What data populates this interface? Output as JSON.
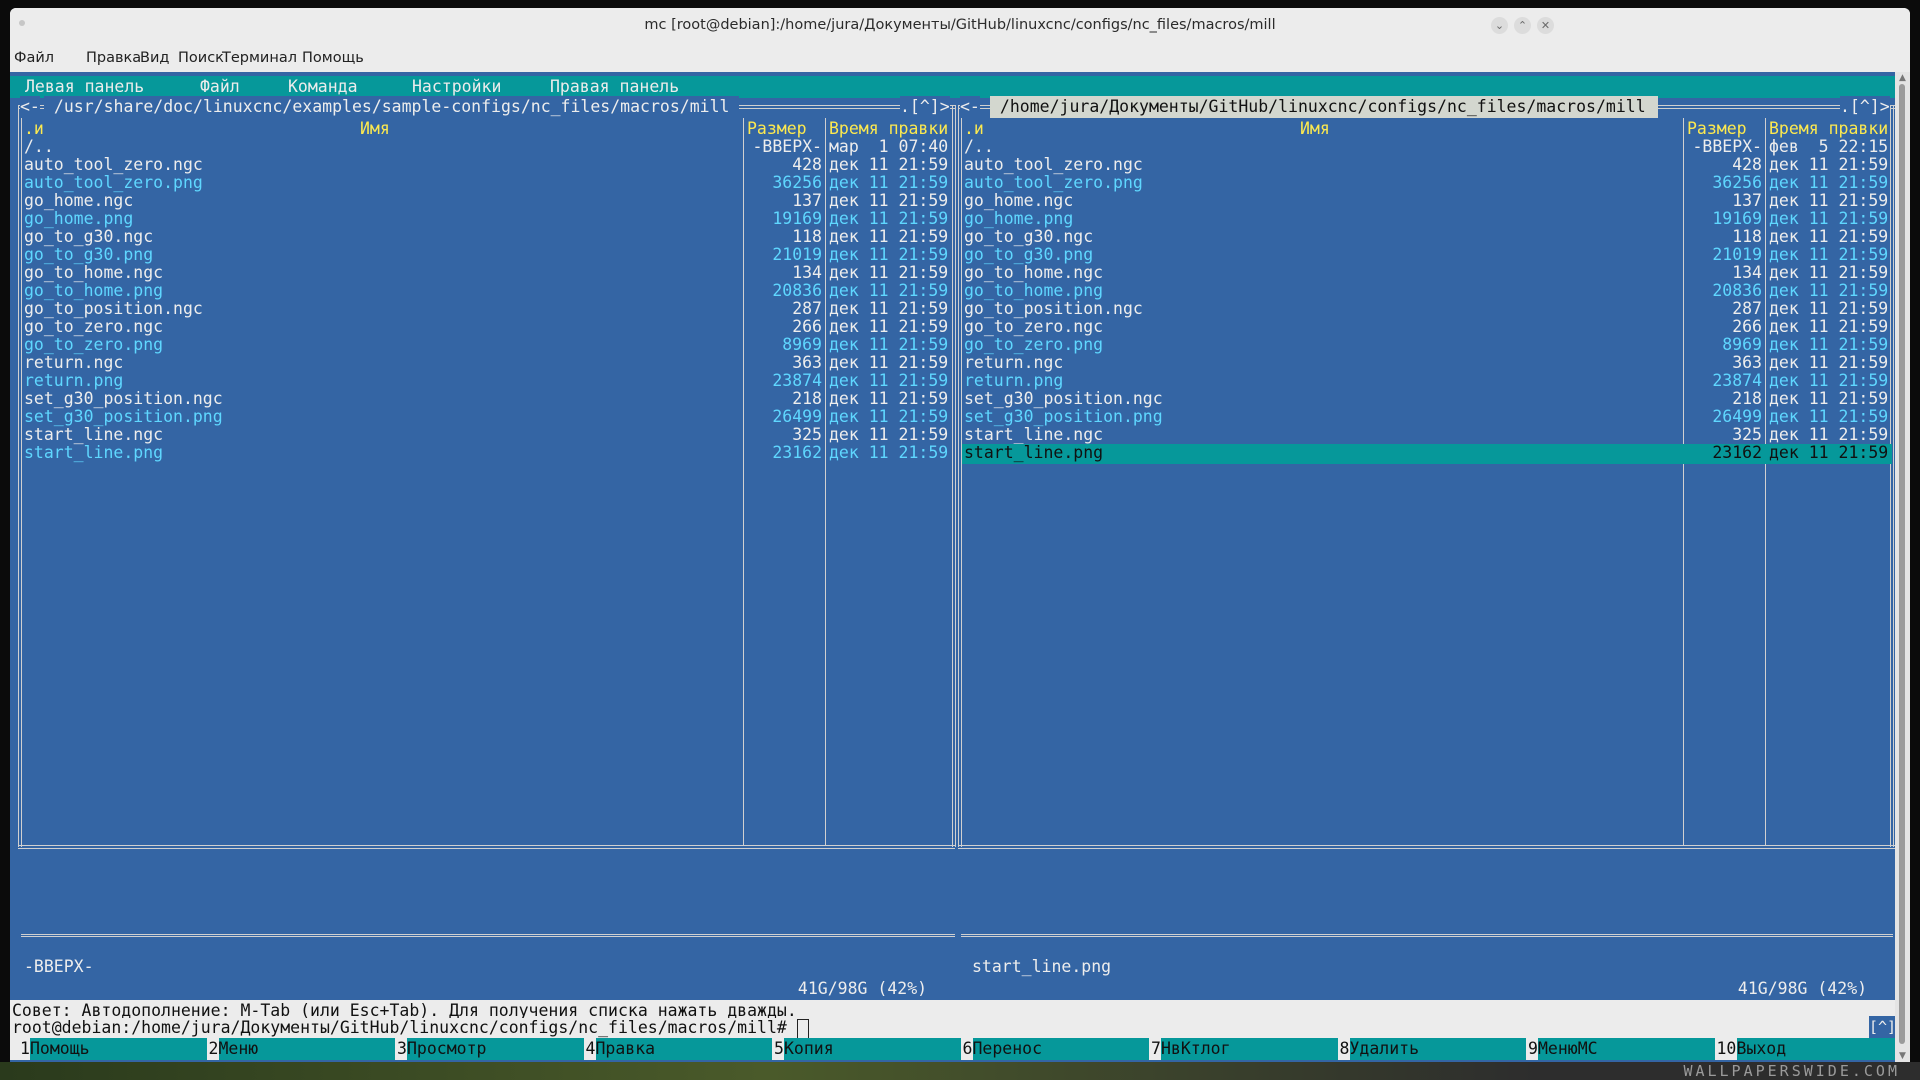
{
  "window": {
    "title": "mc [root@debian]:/home/jura/Документы/GitHub/linuxcnc/configs/nc_files/macros/mill"
  },
  "menubar": [
    "Файл",
    "Правка",
    "Вид",
    "Поиск",
    "Терминал",
    "Помощь"
  ],
  "mc_menu": [
    "Левая панель",
    "Файл",
    "Команда",
    "Настройки",
    "Правая панель"
  ],
  "left_panel": {
    "path": " /usr/share/doc/linuxcnc/examples/sample-configs/nc_files/macros/mill ",
    "sort": ".и",
    "col_name": "Имя",
    "col_size": "Размер",
    "col_time": "Время правки",
    "corner": ".[^]>",
    "up_entry": {
      "name": "/..",
      "size": "-ВВЕРХ-",
      "time": "мар  1 07:40"
    },
    "files": [
      {
        "name": "auto_tool_zero.ngc",
        "size": "428",
        "time": "дек 11 21:59",
        "type": "ngc"
      },
      {
        "name": "auto_tool_zero.png",
        "size": "36256",
        "time": "дек 11 21:59",
        "type": "png"
      },
      {
        "name": "go_home.ngc",
        "size": "137",
        "time": "дек 11 21:59",
        "type": "ngc"
      },
      {
        "name": "go_home.png",
        "size": "19169",
        "time": "дек 11 21:59",
        "type": "png"
      },
      {
        "name": "go_to_g30.ngc",
        "size": "118",
        "time": "дек 11 21:59",
        "type": "ngc"
      },
      {
        "name": "go_to_g30.png",
        "size": "21019",
        "time": "дек 11 21:59",
        "type": "png"
      },
      {
        "name": "go_to_home.ngc",
        "size": "134",
        "time": "дек 11 21:59",
        "type": "ngc"
      },
      {
        "name": "go_to_home.png",
        "size": "20836",
        "time": "дек 11 21:59",
        "type": "png"
      },
      {
        "name": "go_to_position.ngc",
        "size": "287",
        "time": "дек 11 21:59",
        "type": "ngc"
      },
      {
        "name": "go_to_zero.ngc",
        "size": "266",
        "time": "дек 11 21:59",
        "type": "ngc"
      },
      {
        "name": "go_to_zero.png",
        "size": "8969",
        "time": "дек 11 21:59",
        "type": "png"
      },
      {
        "name": "return.ngc",
        "size": "363",
        "time": "дек 11 21:59",
        "type": "ngc"
      },
      {
        "name": "return.png",
        "size": "23874",
        "time": "дек 11 21:59",
        "type": "png"
      },
      {
        "name": "set_g30_position.ngc",
        "size": "218",
        "time": "дек 11 21:59",
        "type": "ngc"
      },
      {
        "name": "set_g30_position.png",
        "size": "26499",
        "time": "дек 11 21:59",
        "type": "png"
      },
      {
        "name": "start_line.ngc",
        "size": "325",
        "time": "дек 11 21:59",
        "type": "ngc"
      },
      {
        "name": "start_line.png",
        "size": "23162",
        "time": "дек 11 21:59",
        "type": "png"
      }
    ],
    "mini_status": "-ВВЕРХ-",
    "disk": " 41G/98G (42%) "
  },
  "right_panel": {
    "path": " /home/jura/Документы/GitHub/linuxcnc/configs/nc_files/macros/mill ",
    "sort": ".и",
    "col_name": "Имя",
    "col_size": "Размер",
    "col_time": "Время правки",
    "corner": ".[^]>",
    "up_entry": {
      "name": "/..",
      "size": "-ВВЕРХ-",
      "time": "фев  5 22:15"
    },
    "files": [
      {
        "name": "auto_tool_zero.ngc",
        "size": "428",
        "time": "дек 11 21:59",
        "type": "ngc"
      },
      {
        "name": "auto_tool_zero.png",
        "size": "36256",
        "time": "дек 11 21:59",
        "type": "png"
      },
      {
        "name": "go_home.ngc",
        "size": "137",
        "time": "дек 11 21:59",
        "type": "ngc"
      },
      {
        "name": "go_home.png",
        "size": "19169",
        "time": "дек 11 21:59",
        "type": "png"
      },
      {
        "name": "go_to_g30.ngc",
        "size": "118",
        "time": "дек 11 21:59",
        "type": "ngc"
      },
      {
        "name": "go_to_g30.png",
        "size": "21019",
        "time": "дек 11 21:59",
        "type": "png"
      },
      {
        "name": "go_to_home.ngc",
        "size": "134",
        "time": "дек 11 21:59",
        "type": "ngc"
      },
      {
        "name": "go_to_home.png",
        "size": "20836",
        "time": "дек 11 21:59",
        "type": "png"
      },
      {
        "name": "go_to_position.ngc",
        "size": "287",
        "time": "дек 11 21:59",
        "type": "ngc"
      },
      {
        "name": "go_to_zero.ngc",
        "size": "266",
        "time": "дек 11 21:59",
        "type": "ngc"
      },
      {
        "name": "go_to_zero.png",
        "size": "8969",
        "time": "дек 11 21:59",
        "type": "png"
      },
      {
        "name": "return.ngc",
        "size": "363",
        "time": "дек 11 21:59",
        "type": "ngc"
      },
      {
        "name": "return.png",
        "size": "23874",
        "time": "дек 11 21:59",
        "type": "png"
      },
      {
        "name": "set_g30_position.ngc",
        "size": "218",
        "time": "дек 11 21:59",
        "type": "ngc"
      },
      {
        "name": "set_g30_position.png",
        "size": "26499",
        "time": "дек 11 21:59",
        "type": "png"
      },
      {
        "name": "start_line.ngc",
        "size": "325",
        "time": "дек 11 21:59",
        "type": "ngc"
      },
      {
        "name": "start_line.png",
        "size": "23162",
        "time": "дек 11 21:59",
        "type": "png",
        "selected": true
      }
    ],
    "mini_status": "start_line.png",
    "disk": " 41G/98G (42%) "
  },
  "hint": "Совет: Автодополнение: M-Tab (или Esc+Tab). Для получения списка нажать дважды.",
  "prompt": "root@debian:/home/jura/Документы/GitHub/linuxcnc/configs/nc_files/macros/mill#",
  "corner_button": "[^]",
  "fkeys": [
    {
      "num": "1",
      "label": "Помощь"
    },
    {
      "num": "2",
      "label": "Меню"
    },
    {
      "num": "3",
      "label": "Просмотр"
    },
    {
      "num": "4",
      "label": "Правка"
    },
    {
      "num": "5",
      "label": "Копия"
    },
    {
      "num": "6",
      "label": "Перенос"
    },
    {
      "num": "7",
      "label": "НвКтлог"
    },
    {
      "num": "8",
      "label": "Удалить"
    },
    {
      "num": "9",
      "label": "МенюMC"
    },
    {
      "num": "10",
      "label": "Выход"
    }
  ],
  "watermark": "WALLPAPERSWIDE.COM",
  "colors": {
    "panel_bg": "#3465a4",
    "selection": "#06989a",
    "header_yellow": "#fce94f",
    "png_cyan": "#5fd7ff"
  }
}
